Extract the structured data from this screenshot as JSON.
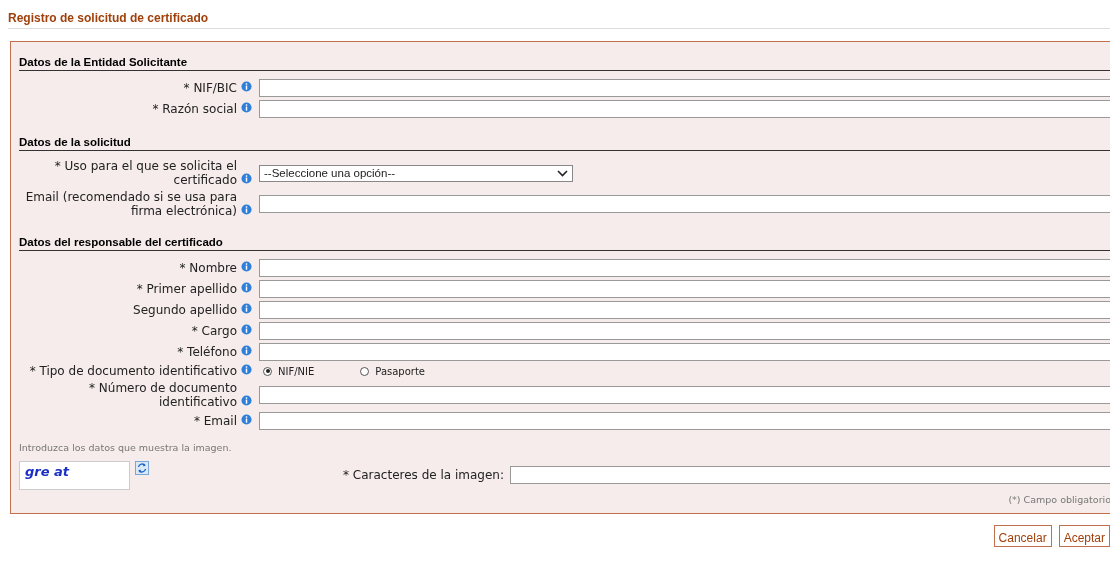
{
  "title": "Registro de solicitud de certificado",
  "sections": [
    {
      "heading": "Datos de la Entidad Solicitante",
      "fields": [
        {
          "kind": "text",
          "label": "* NIF/BIC"
        },
        {
          "kind": "text",
          "label": "* Razón social"
        }
      ]
    },
    {
      "heading": "Datos de la solicitud",
      "fields": [
        {
          "kind": "select",
          "label": "* Uso para el que se solicita el certificado",
          "value": "--Seleccione una opción--"
        },
        {
          "kind": "text",
          "label": "Email (recomendado si se usa para firma electrónica)"
        }
      ]
    },
    {
      "heading": "Datos del responsable del certificado",
      "fields": [
        {
          "kind": "text",
          "label": "* Nombre"
        },
        {
          "kind": "text",
          "label": "* Primer apellido"
        },
        {
          "kind": "text",
          "label": "Segundo apellido"
        },
        {
          "kind": "text",
          "label": "* Cargo"
        },
        {
          "kind": "text",
          "label": "* Teléfono"
        },
        {
          "kind": "radio",
          "label": "* Tipo de documento identificativo",
          "options": [
            {
              "label": "NIF/NIE",
              "selected": true
            },
            {
              "label": "Pasaporte",
              "selected": false
            }
          ]
        },
        {
          "kind": "text",
          "label": "* Número de documento identificativo"
        },
        {
          "kind": "text",
          "label": "* Email"
        }
      ]
    }
  ],
  "captcha": {
    "hint": "Introduzca los datos que muestra la imagen.",
    "image_text": "gre at",
    "label": "* Caracteres de la imagen:"
  },
  "required_note": "(*) Campo obligatorio",
  "buttons": [
    "Cancelar",
    "Aceptar"
  ]
}
